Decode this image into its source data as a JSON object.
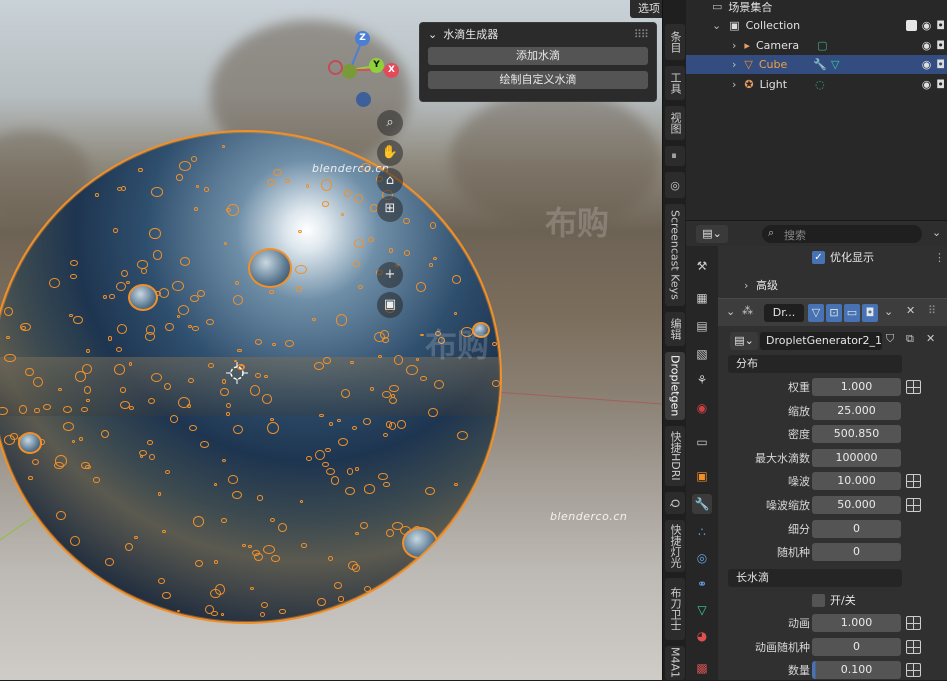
{
  "viewport": {
    "watermark1": "blenderco.cn",
    "watermark2": "blenderco.cn",
    "wm_cn1": "布购",
    "wm_cn2": "布购",
    "gizmo": {
      "z": "Z",
      "y": "Y",
      "x": "X"
    },
    "options_label": "选项",
    "droplet_panel": {
      "title": "水滴生成器",
      "add_button": "添加水滴",
      "paint_button": "绘制自定义水滴"
    },
    "tools": [
      "zoom-icon",
      "hand-pan-icon",
      "camera-icon",
      "grid-icon",
      "plus-icon",
      "render-region-icon"
    ]
  },
  "vtabs": [
    "条目",
    "工具",
    "视图",
    "Screencast Keys",
    "编辑",
    "Dropletgen",
    "快捷HDRI",
    "Q",
    "快捷灯光",
    "布刀卫士",
    "M4A1"
  ],
  "vtabs_active": "Dropletgen",
  "outliner": {
    "scene_collection": "场景集合",
    "collection": "Collection",
    "items": [
      {
        "name": "Camera"
      },
      {
        "name": "Cube"
      },
      {
        "name": "Light"
      }
    ]
  },
  "properties": {
    "search_placeholder": "搜索",
    "optimize_display": "优化显示",
    "advanced": "高级",
    "modifier_name": "Dr...",
    "node_group": "DropletGenerator2_1",
    "section_distribution": "分布",
    "fields": [
      {
        "label": "权重",
        "value": "1.000",
        "key": true
      },
      {
        "label": "缩放",
        "value": "25.000",
        "key": false
      },
      {
        "label": "密度",
        "value": "500.850",
        "key": false
      },
      {
        "label": "最大水滴数",
        "value": "100000",
        "key": false
      },
      {
        "label": "噪波",
        "value": "10.000",
        "key": true
      },
      {
        "label": "噪波缩放",
        "value": "50.000",
        "key": true
      },
      {
        "label": "细分",
        "value": "0",
        "key": false
      },
      {
        "label": "随机种",
        "value": "0",
        "key": false
      }
    ],
    "section_long": "长水滴",
    "toggle_label": "开/关",
    "fields2": [
      {
        "label": "动画",
        "value": "1.000",
        "key": true
      },
      {
        "label": "动画随机种",
        "value": "0",
        "key": true
      },
      {
        "label": "数量",
        "value": "0.100",
        "key": true
      }
    ]
  },
  "colors": {
    "selection_orange": "#f0902a",
    "active_blue": "#4772b3",
    "panel_bg": "#303030"
  }
}
